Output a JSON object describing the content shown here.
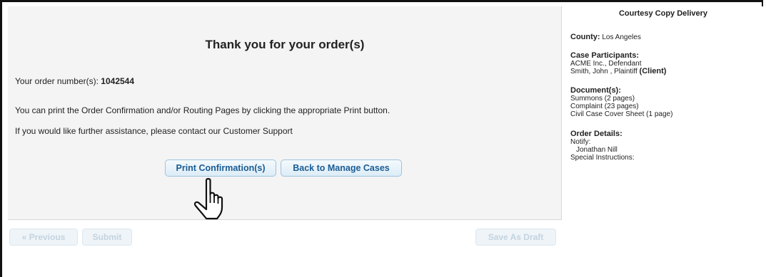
{
  "main": {
    "title": "Thank you for your order(s)",
    "order_label": "Your order number(s):",
    "order_number": "1042544",
    "print_info": "You can print the Order Confirmation and/or Routing Pages by clicking the appropriate Print button.",
    "assist_info": "If you would like further assistance, please contact our Customer Support",
    "buttons": {
      "print": "Print Confirmation(s)",
      "back": "Back to Manage Cases"
    }
  },
  "footer": {
    "previous": "« Previous",
    "submit": "Submit",
    "save_draft": "Save As Draft"
  },
  "sidebar": {
    "title": "Courtesy Copy Delivery",
    "county_label": "County:",
    "county_value": "Los Angeles",
    "participants_label": "Case Participants:",
    "participants": [
      "ACME Inc., Defendant",
      "Smith, John , Plaintiff"
    ],
    "client_tag": "(Client)",
    "documents_label": "Document(s):",
    "documents": [
      "Summons (2 pages)",
      "Complaint (23 pages)",
      "Civil Case Cover Sheet (1 page)"
    ],
    "order_details_label": "Order Details:",
    "notify_label": "Notify:",
    "notify_name": "Jonathan Nill",
    "special_instructions_label": "Special Instructions:"
  },
  "cursor": {
    "icon": "pointer-hand-icon"
  }
}
